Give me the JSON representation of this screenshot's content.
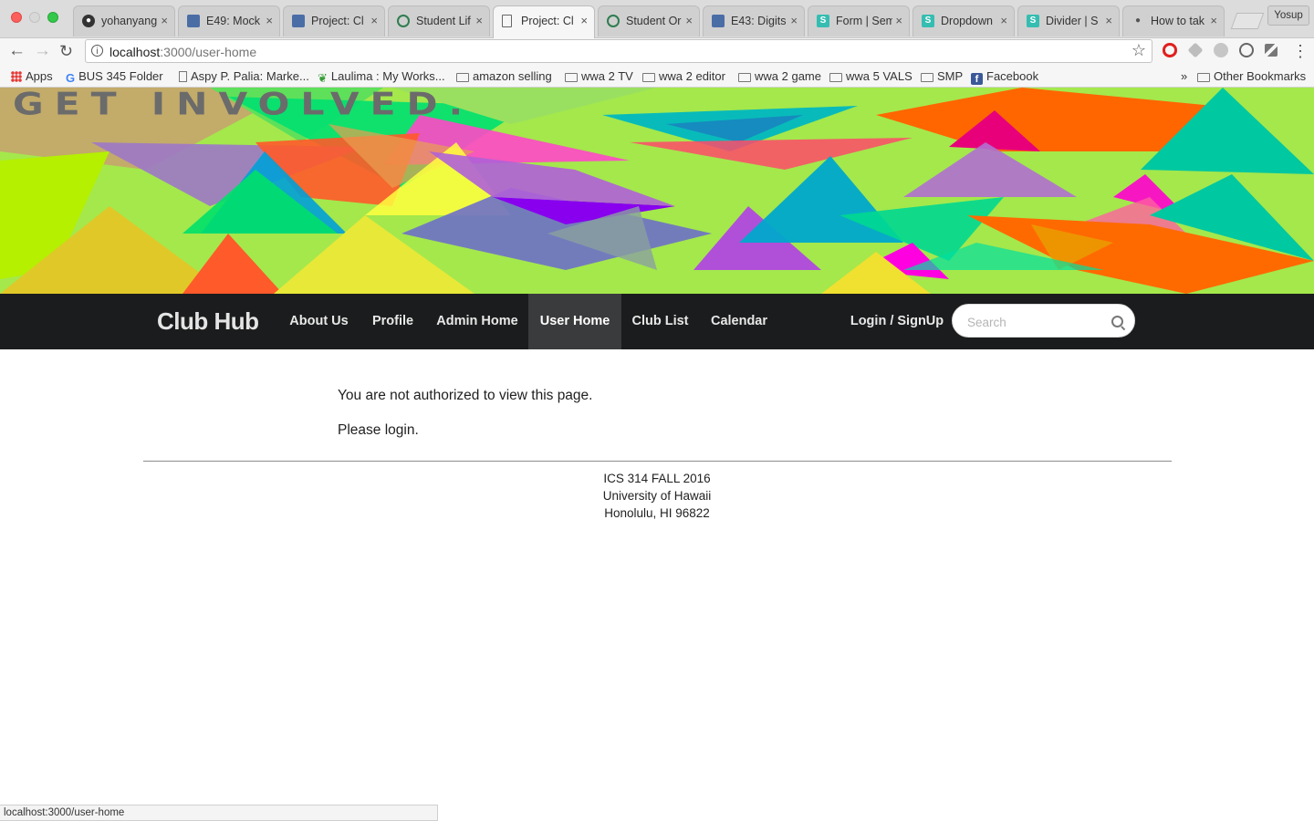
{
  "browser": {
    "tabs": [
      {
        "title": "yohanyang",
        "icon": "github-icon"
      },
      {
        "title": "E49: Mock",
        "icon": "doc-icon"
      },
      {
        "title": "Project: Cl",
        "icon": "doc-icon"
      },
      {
        "title": "Student Lif",
        "icon": "circle-icon"
      },
      {
        "title": "Project: Cl",
        "icon": "page-icon",
        "active": true
      },
      {
        "title": "Student Or",
        "icon": "circle-icon"
      },
      {
        "title": "E43: Digits",
        "icon": "doc-icon"
      },
      {
        "title": "Form | Sem",
        "icon": "semantic-icon"
      },
      {
        "title": "Dropdown",
        "icon": "semantic-icon"
      },
      {
        "title": "Divider | S",
        "icon": "semantic-icon"
      },
      {
        "title": "How to tak",
        "icon": "apple-icon"
      }
    ],
    "tab_close_glyph": "×",
    "profile_name": "Yosup",
    "url_host": "localhost",
    "url_path": ":3000/user-home",
    "bookmarks": [
      {
        "label": "Apps",
        "icon": "apps"
      },
      {
        "label": "BUS 345 Folder",
        "icon": "google"
      },
      {
        "label": "Aspy P. Palia: Marke...",
        "icon": "page"
      },
      {
        "label": "Laulima : My Works...",
        "icon": "leaf"
      },
      {
        "label": "amazon selling",
        "icon": "folder"
      },
      {
        "label": "wwa 2 TV",
        "icon": "folder"
      },
      {
        "label": "wwa 2 editor",
        "icon": "folder"
      },
      {
        "label": "wwa 2 game",
        "icon": "folder"
      },
      {
        "label": "wwa 5 VALS",
        "icon": "folder"
      },
      {
        "label": "SMP",
        "icon": "folder"
      },
      {
        "label": "Facebook",
        "icon": "facebook"
      }
    ],
    "overflow_label": "»",
    "other_bookmarks": "Other Bookmarks",
    "status_url": "localhost:3000/user-home"
  },
  "banner": {
    "title": "GET INVOLVED."
  },
  "nav": {
    "brand": "Club Hub",
    "items": [
      {
        "label": "About Us"
      },
      {
        "label": "Profile"
      },
      {
        "label": "Admin Home"
      },
      {
        "label": "User Home",
        "active": true
      },
      {
        "label": "Club List"
      },
      {
        "label": "Calendar"
      }
    ],
    "login_label": "Login / SignUp",
    "search_placeholder": "Search"
  },
  "main": {
    "message_line1": "You are not authorized to view this page.",
    "message_line2": "Please login."
  },
  "footer": {
    "line1": "ICS 314 FALL 2016",
    "line2": "University of Hawaii",
    "line3": "Honolulu, HI 96822"
  },
  "colors": {
    "nav_background": "#1b1c1d",
    "nav_active": "#3a3b3c",
    "banner_base": "#a4e84c"
  }
}
